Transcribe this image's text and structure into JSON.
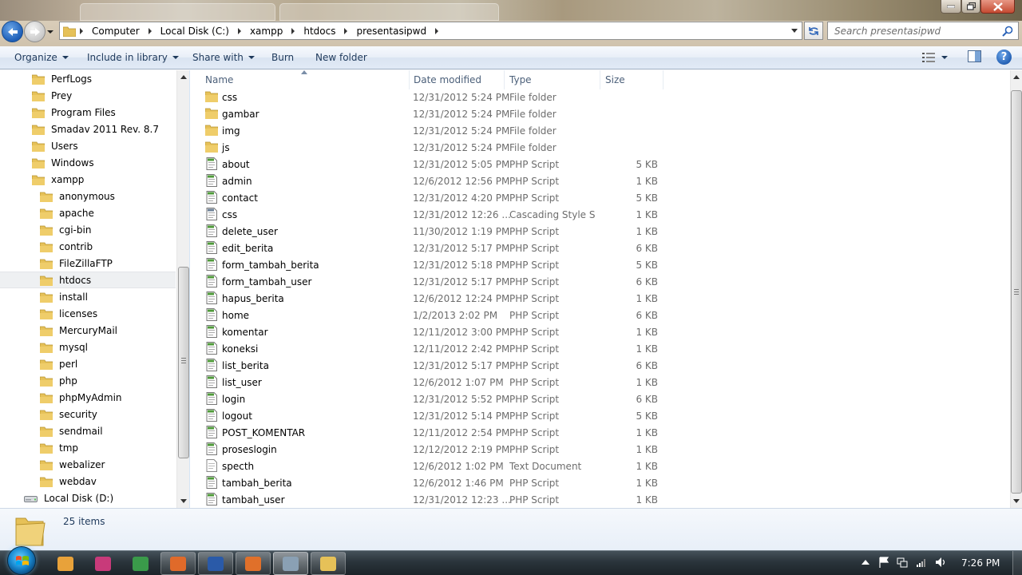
{
  "breadcrumb": [
    "Computer",
    "Local Disk (C:)",
    "xampp",
    "htdocs",
    "presentasipwd"
  ],
  "search": {
    "placeholder": "Search presentasipwd"
  },
  "toolbar": {
    "organize": "Organize",
    "include_in_library": "Include in library",
    "share_with": "Share with",
    "burn": "Burn",
    "new_folder": "New folder"
  },
  "nav_tree": [
    {
      "label": "PerfLogs",
      "indent": 1,
      "icon": "folder-icon"
    },
    {
      "label": "Prey",
      "indent": 1,
      "icon": "folder-icon"
    },
    {
      "label": "Program Files",
      "indent": 1,
      "icon": "folder-icon"
    },
    {
      "label": "Smadav 2011 Rev. 8.7",
      "indent": 1,
      "icon": "folder-icon"
    },
    {
      "label": "Users",
      "indent": 1,
      "icon": "folder-icon"
    },
    {
      "label": "Windows",
      "indent": 1,
      "icon": "folder-icon"
    },
    {
      "label": "xampp",
      "indent": 1,
      "icon": "folder-icon"
    },
    {
      "label": "anonymous",
      "indent": 2,
      "icon": "folder-icon"
    },
    {
      "label": "apache",
      "indent": 2,
      "icon": "folder-icon"
    },
    {
      "label": "cgi-bin",
      "indent": 2,
      "icon": "folder-icon"
    },
    {
      "label": "contrib",
      "indent": 2,
      "icon": "folder-icon"
    },
    {
      "label": "FileZillaFTP",
      "indent": 2,
      "icon": "folder-icon"
    },
    {
      "label": "htdocs",
      "indent": 2,
      "icon": "folder-icon",
      "selected": true
    },
    {
      "label": "install",
      "indent": 2,
      "icon": "folder-icon"
    },
    {
      "label": "licenses",
      "indent": 2,
      "icon": "folder-icon"
    },
    {
      "label": "MercuryMail",
      "indent": 2,
      "icon": "folder-icon"
    },
    {
      "label": "mysql",
      "indent": 2,
      "icon": "folder-icon"
    },
    {
      "label": "perl",
      "indent": 2,
      "icon": "folder-icon"
    },
    {
      "label": "php",
      "indent": 2,
      "icon": "folder-icon"
    },
    {
      "label": "phpMyAdmin",
      "indent": 2,
      "icon": "folder-icon"
    },
    {
      "label": "security",
      "indent": 2,
      "icon": "folder-icon"
    },
    {
      "label": "sendmail",
      "indent": 2,
      "icon": "folder-icon"
    },
    {
      "label": "tmp",
      "indent": 2,
      "icon": "folder-icon"
    },
    {
      "label": "webalizer",
      "indent": 2,
      "icon": "folder-icon"
    },
    {
      "label": "webdav",
      "indent": 2,
      "icon": "folder-icon"
    },
    {
      "label": "Local Disk (D:)",
      "indent": 0,
      "icon": "drive-icon"
    }
  ],
  "columns": {
    "name": "Name",
    "date": "Date modified",
    "type": "Type",
    "size": "Size"
  },
  "files": [
    {
      "name": "css",
      "date": "12/31/2012 5:24 PM",
      "type": "File folder",
      "size": "",
      "icon": "folder-icon"
    },
    {
      "name": "gambar",
      "date": "12/31/2012 5:24 PM",
      "type": "File folder",
      "size": "",
      "icon": "folder-icon"
    },
    {
      "name": "img",
      "date": "12/31/2012 5:24 PM",
      "type": "File folder",
      "size": "",
      "icon": "folder-icon"
    },
    {
      "name": "js",
      "date": "12/31/2012 5:24 PM",
      "type": "File folder",
      "size": "",
      "icon": "folder-icon"
    },
    {
      "name": "about",
      "date": "12/31/2012 5:05 PM",
      "type": "PHP Script",
      "size": "5 KB",
      "icon": "php-file-icon"
    },
    {
      "name": "admin",
      "date": "12/6/2012 12:56 PM",
      "type": "PHP Script",
      "size": "1 KB",
      "icon": "php-file-icon"
    },
    {
      "name": "contact",
      "date": "12/31/2012 4:20 PM",
      "type": "PHP Script",
      "size": "5 KB",
      "icon": "php-file-icon"
    },
    {
      "name": "css",
      "date": "12/31/2012 12:26 ...",
      "type": "Cascading Style S...",
      "size": "1 KB",
      "icon": "css-file-icon"
    },
    {
      "name": "delete_user",
      "date": "11/30/2012 1:19 PM",
      "type": "PHP Script",
      "size": "1 KB",
      "icon": "php-file-icon"
    },
    {
      "name": "edit_berita",
      "date": "12/31/2012 5:17 PM",
      "type": "PHP Script",
      "size": "6 KB",
      "icon": "php-file-icon"
    },
    {
      "name": "form_tambah_berita",
      "date": "12/31/2012 5:18 PM",
      "type": "PHP Script",
      "size": "5 KB",
      "icon": "php-file-icon"
    },
    {
      "name": "form_tambah_user",
      "date": "12/31/2012 5:17 PM",
      "type": "PHP Script",
      "size": "6 KB",
      "icon": "php-file-icon"
    },
    {
      "name": "hapus_berita",
      "date": "12/6/2012 12:24 PM",
      "type": "PHP Script",
      "size": "1 KB",
      "icon": "php-file-icon"
    },
    {
      "name": "home",
      "date": "1/2/2013 2:02 PM",
      "type": "PHP Script",
      "size": "6 KB",
      "icon": "php-file-icon"
    },
    {
      "name": "komentar",
      "date": "12/11/2012 3:00 PM",
      "type": "PHP Script",
      "size": "1 KB",
      "icon": "php-file-icon"
    },
    {
      "name": "koneksi",
      "date": "12/11/2012 2:42 PM",
      "type": "PHP Script",
      "size": "1 KB",
      "icon": "php-file-icon"
    },
    {
      "name": "list_berita",
      "date": "12/31/2012 5:17 PM",
      "type": "PHP Script",
      "size": "6 KB",
      "icon": "php-file-icon"
    },
    {
      "name": "list_user",
      "date": "12/6/2012 1:07 PM",
      "type": "PHP Script",
      "size": "1 KB",
      "icon": "php-file-icon"
    },
    {
      "name": "login",
      "date": "12/31/2012 5:52 PM",
      "type": "PHP Script",
      "size": "6 KB",
      "icon": "php-file-icon"
    },
    {
      "name": "logout",
      "date": "12/31/2012 5:14 PM",
      "type": "PHP Script",
      "size": "5 KB",
      "icon": "php-file-icon"
    },
    {
      "name": "POST_KOMENTAR",
      "date": "12/11/2012 2:54 PM",
      "type": "PHP Script",
      "size": "1 KB",
      "icon": "php-file-icon"
    },
    {
      "name": "proseslogin",
      "date": "12/12/2012 2:19 PM",
      "type": "PHP Script",
      "size": "1 KB",
      "icon": "php-file-icon"
    },
    {
      "name": "specth",
      "date": "12/6/2012 1:02 PM",
      "type": "Text Document",
      "size": "1 KB",
      "icon": "text-file-icon"
    },
    {
      "name": "tambah_berita",
      "date": "12/6/2012 1:46 PM",
      "type": "PHP Script",
      "size": "1 KB",
      "icon": "php-file-icon"
    },
    {
      "name": "tambah_user",
      "date": "12/31/2012 12:23 ...",
      "type": "PHP Script",
      "size": "1 KB",
      "icon": "php-file-icon"
    }
  ],
  "details": {
    "item_count": "25 items"
  },
  "taskbar": {
    "apps": [
      {
        "name": "media-player-icon",
        "color": "#e8a23a"
      },
      {
        "name": "app-c-icon",
        "color": "#c83a7a"
      },
      {
        "name": "chrome-icon",
        "color": "#3a9a4a"
      },
      {
        "name": "sublime-icon",
        "color": "#e06a2a",
        "running": true
      },
      {
        "name": "word-icon",
        "color": "#2a5aa8",
        "running": true
      },
      {
        "name": "firefox-icon",
        "color": "#e0702a",
        "running": true
      },
      {
        "name": "explorer-snake-icon",
        "color": "#8aa0b4",
        "running": true,
        "active": true
      },
      {
        "name": "windows-explorer-icon",
        "color": "#e6c158",
        "running": true
      }
    ],
    "tray": [
      "show-hidden-icons-icon",
      "action-center-flag-icon",
      "network-adapter-icon",
      "signal-icon",
      "volume-icon"
    ],
    "clock": "7:26 PM"
  },
  "colors": {
    "accent": "#1e395b",
    "header_text": "#4c607a",
    "secondary_text": "#6d6d6d",
    "folder": "#e6c158"
  }
}
